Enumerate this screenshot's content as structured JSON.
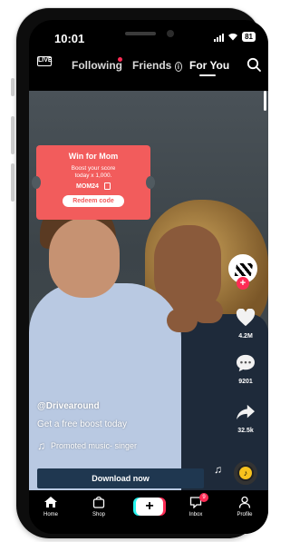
{
  "status_bar": {
    "time": "10:01",
    "battery": "81"
  },
  "top_nav": {
    "live_label": "LIVE",
    "tabs": [
      {
        "label": "Following",
        "has_notification_dot": true
      },
      {
        "label": "Friends",
        "info_icon": "info-icon"
      },
      {
        "label": "For You",
        "active": true
      }
    ],
    "search_icon": "search-icon"
  },
  "promo": {
    "title": "Win for Mom",
    "subtitle_line1": "Boost your score",
    "subtitle_line2": "today x 1,000.",
    "code": "MOM24",
    "button_label": "Redeem code",
    "color": "#f25c5c"
  },
  "right_rail": {
    "likes": "4.2M",
    "comments": "9201",
    "shares": "32.5k"
  },
  "caption": {
    "username": "@Drivearound",
    "description": "Get a free boost today",
    "music": "Promoted music- singer"
  },
  "cta": {
    "label": "Download now"
  },
  "bottom_nav": {
    "items": [
      {
        "label": "Home",
        "icon": "home-icon"
      },
      {
        "label": "Shop",
        "icon": "shop-icon"
      },
      {
        "label": "",
        "icon": "create-icon"
      },
      {
        "label": "Inbox",
        "icon": "inbox-icon",
        "badge": "9"
      },
      {
        "label": "Profile",
        "icon": "profile-icon"
      }
    ]
  },
  "colors": {
    "accent_red": "#fe2c55",
    "accent_cyan": "#25f4ee",
    "cta_bg": "#1f3750"
  }
}
